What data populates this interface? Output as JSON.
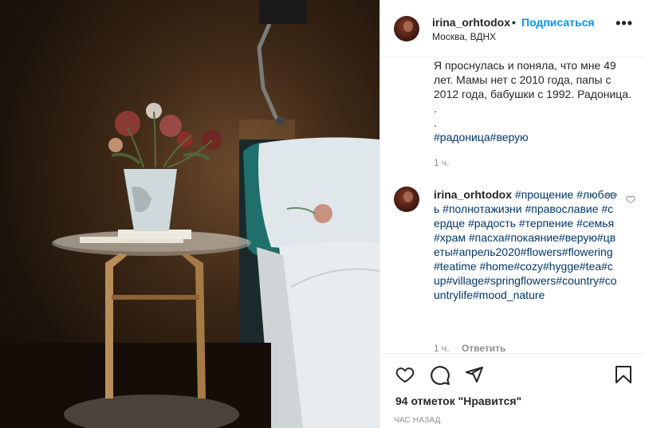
{
  "post": {
    "username": "irina_orhtodox",
    "separator": "•",
    "follow_label": "Подписаться",
    "location": "Москва, ВДНХ",
    "more_label": "•••"
  },
  "caption": {
    "text": "Я проснулась и поняла, что мне 49 лет. Мамы нет с 2010 года, папы с 2012 года, бабушки с 1992. Радоница. .",
    "dot_line": ".",
    "hashtags": "#радоница#верую",
    "time": "1 ч."
  },
  "comment": {
    "username": "irina_orhtodox",
    "hashtags": "#прощение #любовь #полнотажизни #православие #сердце #радость #терпение #семья #храм #пасха#покаяние#верую#цветы#апрель2020#flowers#flowering#teatime #home#cozy#hygge#tea#cup#village#springflowers#country#countrylife#mood_nature",
    "more_label": "•••",
    "time": "1 ч.",
    "reply_label": "Ответить"
  },
  "actions": {
    "like_icon": "heart-icon",
    "comment_icon": "comment-icon",
    "share_icon": "share-icon",
    "save_icon": "bookmark-icon",
    "likes_text": "94 отметок \"Нравится\"",
    "posted_ago": "час назад"
  },
  "colors": {
    "link": "#0095f6",
    "hashtag": "#00376b",
    "muted": "#8e8e8e",
    "text": "#262626"
  }
}
